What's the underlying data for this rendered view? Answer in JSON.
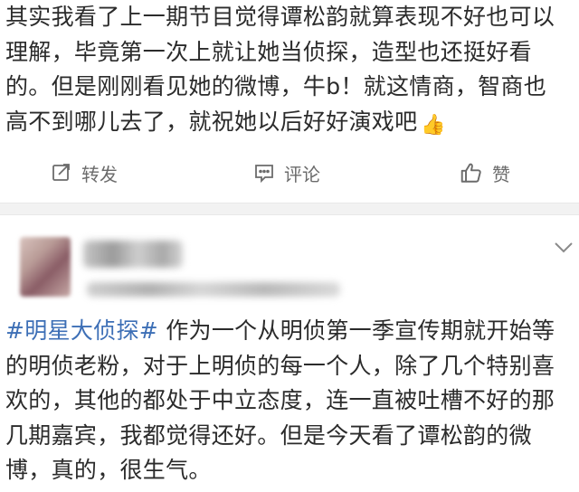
{
  "post1": {
    "lines": [
      "其实我看了上一期节目觉得谭松韵就算表现不好也可以",
      "理解，毕竟第一次上就让她当侦探，造型也还挺好看",
      "的。但是刚刚看见她的微博，牛b！就这情商，智商也",
      "高不到哪儿去了，就祝她以后好好演戏吧"
    ],
    "emoji": "👍"
  },
  "actions": {
    "repost_label": "转发",
    "comment_label": "评论",
    "like_label": "赞"
  },
  "post2": {
    "hashtag": "#明星大侦探#",
    "line1_rest": " 作为一个从明侦第一季宣传期就开始等",
    "lines": [
      "的明侦老粉，对于上明侦的每一个人，除了几个特别喜",
      "欢的，其他的都处于中立态度，连一直被吐槽不好的那",
      "几期嘉宾，我都觉得还好。但是今天看了谭松韵的微",
      "博，真的，很生气。"
    ]
  },
  "icons": {
    "repost": "repost-icon",
    "comment": "comment-icon",
    "like": "thumbs-up-icon",
    "menu": "chevron-down-icon"
  }
}
